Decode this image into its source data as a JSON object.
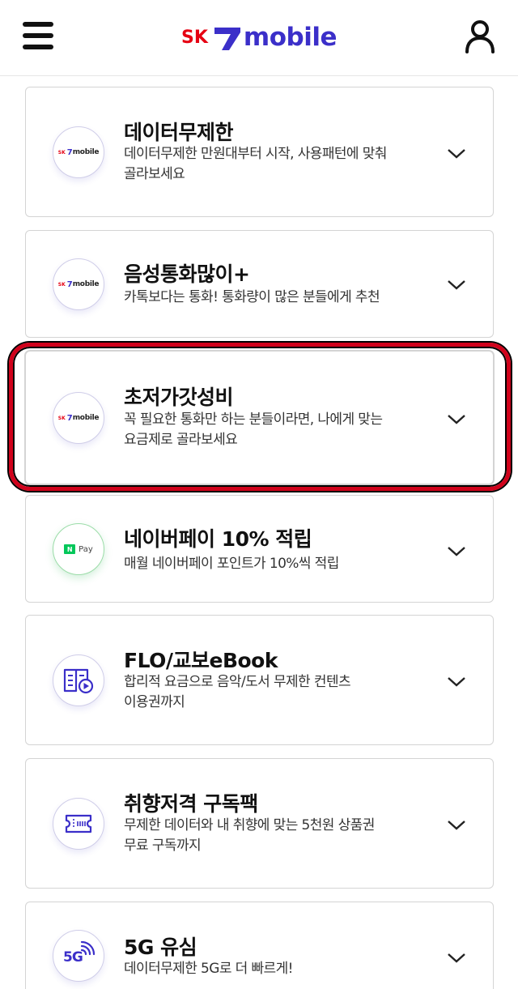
{
  "header": {
    "logo_sk": "SK",
    "logo_word": "mobile"
  },
  "plans": [
    {
      "title": "데이터무제한",
      "desc_line1": "데이터무제한 만원대부터 시작, 사용패턴에 맞춰",
      "desc_line2": "골라보세요",
      "icon": "sk7mobile-logo-icon"
    },
    {
      "title": "음성통화많이+",
      "desc_line1": "카톡보다는 통화! 통화량이 많은 분들에게 추천",
      "desc_line2": "",
      "icon": "sk7mobile-logo-icon"
    },
    {
      "title": "초저가갓성비",
      "desc_line1": "꼭 필요한 통화만 하는 분들이라면, 나에게 맞는",
      "desc_line2": "요금제로 골라보세요",
      "icon": "sk7mobile-logo-icon"
    },
    {
      "title": "네이버페이 10% 적립",
      "desc_line1": "매월 네이버페이 포인트가 10%씩 적립",
      "desc_line2": "",
      "icon": "naver-pay-icon",
      "icon_label_n": "N",
      "icon_label_pay": "Pay"
    },
    {
      "title": "FLO/교보eBook",
      "desc_line1": "합리적 요금으로 음악/도서 무제한 컨텐츠",
      "desc_line2": "이용권까지",
      "icon": "book-music-icon"
    },
    {
      "title": "취향저격 구독팩",
      "desc_line1": "무제한 데이터와 내 취향에 맞는 5천원 상품권",
      "desc_line2": "무료 구독까지",
      "icon": "ticket-icon"
    },
    {
      "title": "5G 유심",
      "desc_line1": "데이터무제한 5G로 더 빠르게!",
      "desc_line2": "",
      "icon": "5g-icon",
      "icon_label": "5G"
    }
  ],
  "colors": {
    "brand_red": "#e60012",
    "brand_purple": "#3b2fc9",
    "highlight_red": "#d0021b",
    "naver_green": "#03c75a"
  }
}
